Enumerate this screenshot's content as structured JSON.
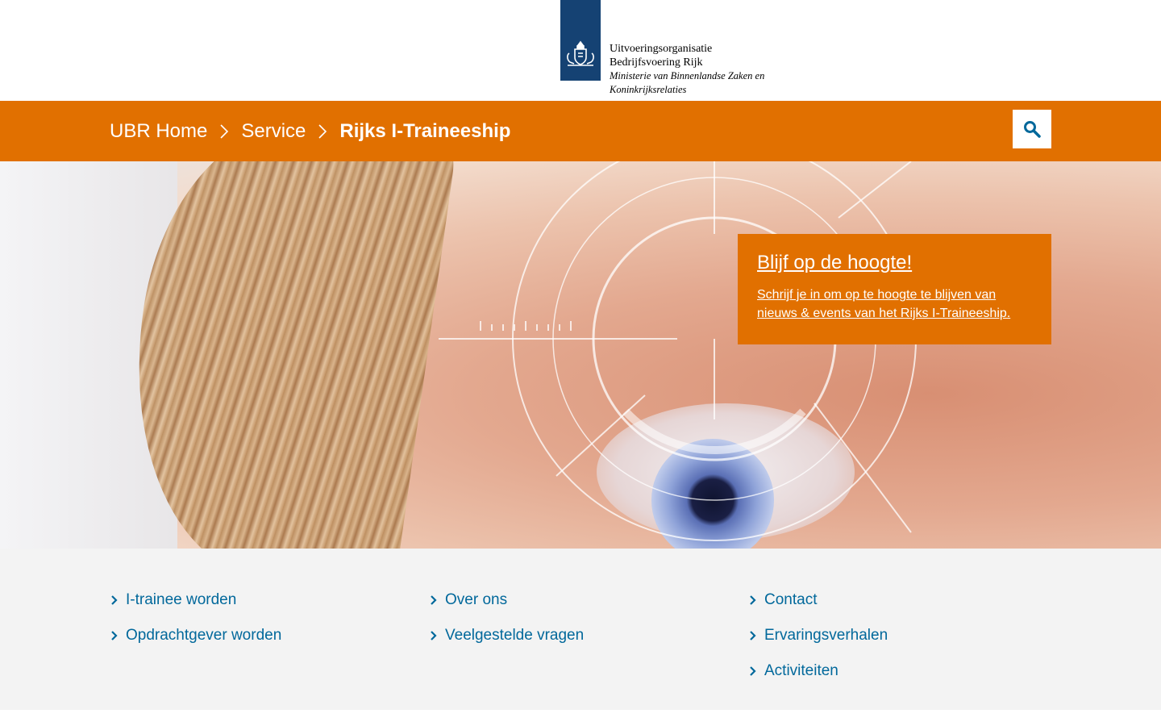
{
  "header": {
    "org_line1": "Uitvoeringsorganisatie",
    "org_line2": "Bedrijfsvoering Rijk",
    "ministry_line1": "Ministerie van Binnenlandse Zaken en",
    "ministry_line2": "Koninkrijksrelaties"
  },
  "breadcrumb": {
    "items": [
      "UBR Home",
      "Service",
      "Rijks I-Traineeship"
    ]
  },
  "promo": {
    "title": "Blijf op de hoogte!",
    "text": "Schrijf je in om op te hoogte te blijven van nieuws & events van het Rijks I-Traineeship."
  },
  "links": {
    "col1": [
      "I-trainee worden",
      "Opdrachtgever worden"
    ],
    "col2": [
      "Over ons",
      "Veelgestelde vragen"
    ],
    "col3": [
      "Contact",
      "Ervaringsverhalen",
      "Activiteiten"
    ]
  },
  "icons": {
    "search": "search-icon",
    "chevron": "chevron-right-icon",
    "emblem": "coat-of-arms-icon"
  },
  "colors": {
    "brand_orange": "#e17000",
    "link_blue": "#01689b",
    "logo_blue": "#154273",
    "footer_bg": "#f3f3f3"
  }
}
